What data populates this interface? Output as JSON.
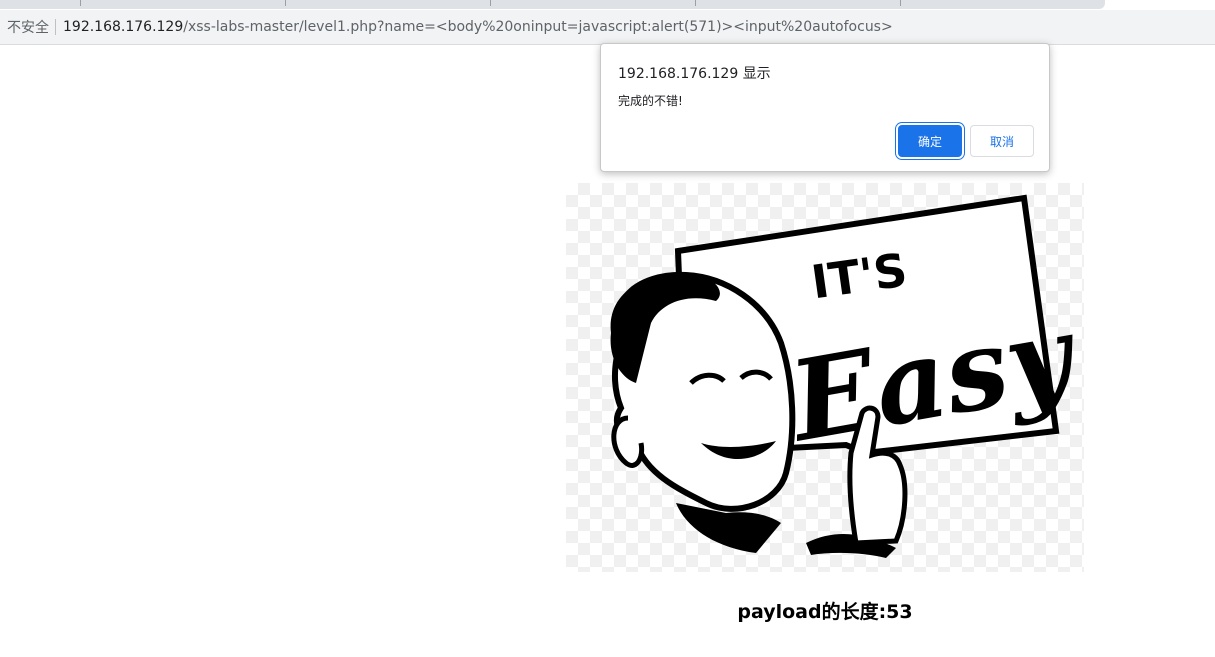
{
  "browser": {
    "security_label": "不安全",
    "url_host": "192.168.176.129",
    "url_rest": "/xss-labs-master/level1.php?name=<body%20oninput=javascript:alert(571)><input%20autofocus>"
  },
  "dialog": {
    "title": "192.168.176.129 显示",
    "message": "完成的不错!",
    "ok_label": "确定",
    "cancel_label": "取消",
    "accent_color": "#1a73e8"
  },
  "page": {
    "image_sign_line1": "IT'S",
    "image_sign_line2": "Easy",
    "payload_text": "payload的长度:53"
  }
}
